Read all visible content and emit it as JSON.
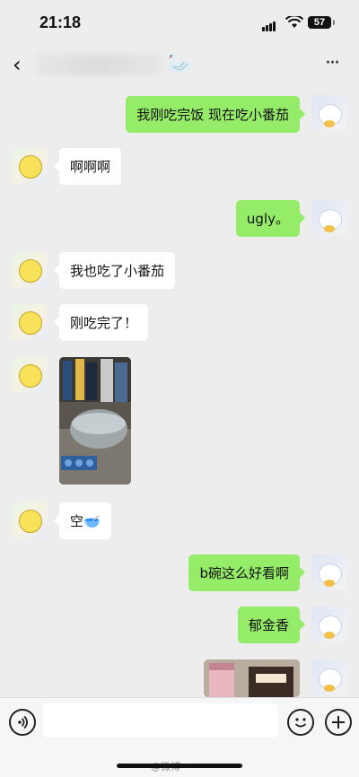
{
  "status": {
    "time": "21:18",
    "battery": "57"
  },
  "nav": {
    "back_icon": "back-chevron-icon",
    "title_emoji": "🦢",
    "more_icon": "more-dots-icon",
    "more_glyph": "···"
  },
  "messages": [
    {
      "side": "right",
      "text": "我刚吃完饭 现在吃小番茄"
    },
    {
      "side": "left",
      "text": "啊啊啊"
    },
    {
      "side": "right",
      "text": "ugly。"
    },
    {
      "side": "left",
      "text": "我也吃了小番茄"
    },
    {
      "side": "left",
      "text": "刚吃完了！"
    },
    {
      "side": "left",
      "type": "image",
      "image": "photo of glass bowl on table"
    },
    {
      "side": "left",
      "text": "空🥣"
    },
    {
      "side": "right",
      "text": "b碗这么好看啊"
    },
    {
      "side": "right",
      "text": "郁金香"
    },
    {
      "side": "right",
      "type": "image",
      "image": "photo of snacks and jar"
    }
  ],
  "input": {
    "placeholder": "",
    "voice_icon": "voice-icon",
    "emoji_icon": "emoji-icon",
    "plus_icon": "plus-icon"
  },
  "watermark": "@微博"
}
